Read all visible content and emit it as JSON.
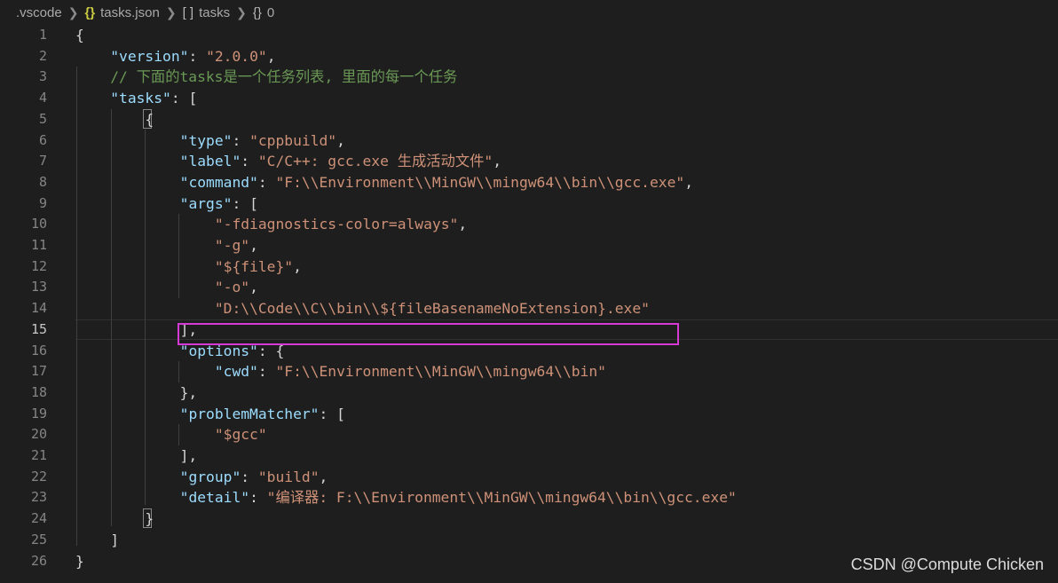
{
  "breadcrumb": {
    "folder": ".vscode",
    "file_icon": "{}",
    "file": "tasks.json",
    "array_icon": "[ ]",
    "array": "tasks",
    "object_icon": "{}",
    "object": "0"
  },
  "editor": {
    "current_line": 15,
    "highlighted_line": 14,
    "highlight_color": "#d63ad6"
  },
  "lines": [
    {
      "n": "1",
      "parts": [
        [
          "p",
          "{"
        ]
      ]
    },
    {
      "n": "2",
      "parts": [
        [
          "p",
          "    "
        ],
        [
          "k",
          "\"version\""
        ],
        [
          "p",
          ": "
        ],
        [
          "s",
          "\"2.0.0\""
        ],
        [
          "p",
          ","
        ]
      ]
    },
    {
      "n": "3",
      "parts": [
        [
          "p",
          "    "
        ],
        [
          "c",
          "// 下面的tasks是一个任务列表, 里面的每一个任务"
        ]
      ]
    },
    {
      "n": "4",
      "parts": [
        [
          "p",
          "    "
        ],
        [
          "k",
          "\"tasks\""
        ],
        [
          "p",
          ": ["
        ]
      ]
    },
    {
      "n": "5",
      "parts": [
        [
          "p",
          "        {"
        ]
      ]
    },
    {
      "n": "6",
      "parts": [
        [
          "p",
          "            "
        ],
        [
          "k",
          "\"type\""
        ],
        [
          "p",
          ": "
        ],
        [
          "s",
          "\"cppbuild\""
        ],
        [
          "p",
          ","
        ]
      ]
    },
    {
      "n": "7",
      "parts": [
        [
          "p",
          "            "
        ],
        [
          "k",
          "\"label\""
        ],
        [
          "p",
          ": "
        ],
        [
          "s",
          "\"C/C++: gcc.exe 生成活动文件\""
        ],
        [
          "p",
          ","
        ]
      ]
    },
    {
      "n": "8",
      "parts": [
        [
          "p",
          "            "
        ],
        [
          "k",
          "\"command\""
        ],
        [
          "p",
          ": "
        ],
        [
          "s",
          "\"F:\\\\Environment\\\\MinGW\\\\mingw64\\\\bin\\\\gcc.exe\""
        ],
        [
          "p",
          ","
        ]
      ]
    },
    {
      "n": "9",
      "parts": [
        [
          "p",
          "            "
        ],
        [
          "k",
          "\"args\""
        ],
        [
          "p",
          ": ["
        ]
      ]
    },
    {
      "n": "10",
      "parts": [
        [
          "p",
          "                "
        ],
        [
          "s",
          "\"-fdiagnostics-color=always\""
        ],
        [
          "p",
          ","
        ]
      ]
    },
    {
      "n": "11",
      "parts": [
        [
          "p",
          "                "
        ],
        [
          "s",
          "\"-g\""
        ],
        [
          "p",
          ","
        ]
      ]
    },
    {
      "n": "12",
      "parts": [
        [
          "p",
          "                "
        ],
        [
          "s",
          "\"${file}\""
        ],
        [
          "p",
          ","
        ]
      ]
    },
    {
      "n": "13",
      "parts": [
        [
          "p",
          "                "
        ],
        [
          "s",
          "\"-o\""
        ],
        [
          "p",
          ","
        ]
      ]
    },
    {
      "n": "14",
      "parts": [
        [
          "p",
          "                "
        ],
        [
          "s",
          "\"D:\\\\Code\\\\C\\\\bin\\\\${fileBasenameNoExtension}.exe\""
        ]
      ]
    },
    {
      "n": "15",
      "parts": [
        [
          "p",
          "            ],"
        ]
      ]
    },
    {
      "n": "16",
      "parts": [
        [
          "p",
          "            "
        ],
        [
          "k",
          "\"options\""
        ],
        [
          "p",
          ": {"
        ]
      ]
    },
    {
      "n": "17",
      "parts": [
        [
          "p",
          "                "
        ],
        [
          "k",
          "\"cwd\""
        ],
        [
          "p",
          ": "
        ],
        [
          "s",
          "\"F:\\\\Environment\\\\MinGW\\\\mingw64\\\\bin\""
        ]
      ]
    },
    {
      "n": "18",
      "parts": [
        [
          "p",
          "            },"
        ]
      ]
    },
    {
      "n": "19",
      "parts": [
        [
          "p",
          "            "
        ],
        [
          "k",
          "\"problemMatcher\""
        ],
        [
          "p",
          ": ["
        ]
      ]
    },
    {
      "n": "20",
      "parts": [
        [
          "p",
          "                "
        ],
        [
          "s",
          "\"$gcc\""
        ]
      ]
    },
    {
      "n": "21",
      "parts": [
        [
          "p",
          "            ],"
        ]
      ]
    },
    {
      "n": "22",
      "parts": [
        [
          "p",
          "            "
        ],
        [
          "k",
          "\"group\""
        ],
        [
          "p",
          ": "
        ],
        [
          "s",
          "\"build\""
        ],
        [
          "p",
          ","
        ]
      ]
    },
    {
      "n": "23",
      "parts": [
        [
          "p",
          "            "
        ],
        [
          "k",
          "\"detail\""
        ],
        [
          "p",
          ": "
        ],
        [
          "s",
          "\"编译器: F:\\\\Environment\\\\MinGW\\\\mingw64\\\\bin\\\\gcc.exe\""
        ]
      ]
    },
    {
      "n": "24",
      "parts": [
        [
          "p",
          "        }"
        ]
      ]
    },
    {
      "n": "25",
      "parts": [
        [
          "p",
          "    ]"
        ]
      ]
    },
    {
      "n": "26",
      "parts": [
        [
          "p",
          "}"
        ]
      ]
    }
  ],
  "watermark": "CSDN @Compute Chicken"
}
